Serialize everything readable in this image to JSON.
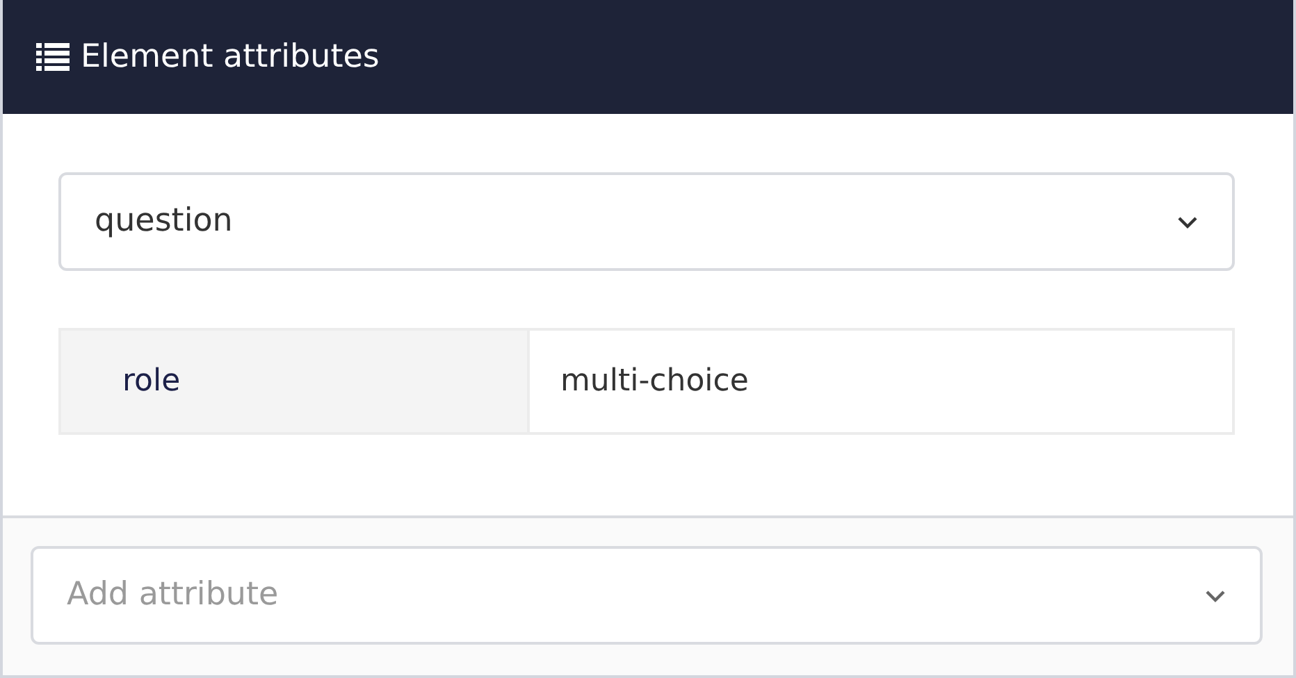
{
  "panel": {
    "title": "Element attributes"
  },
  "element_select": {
    "value": "question"
  },
  "attributes": [
    {
      "name": "role",
      "value": "multi-choice"
    }
  ],
  "add_attribute": {
    "placeholder": "Add attribute"
  }
}
